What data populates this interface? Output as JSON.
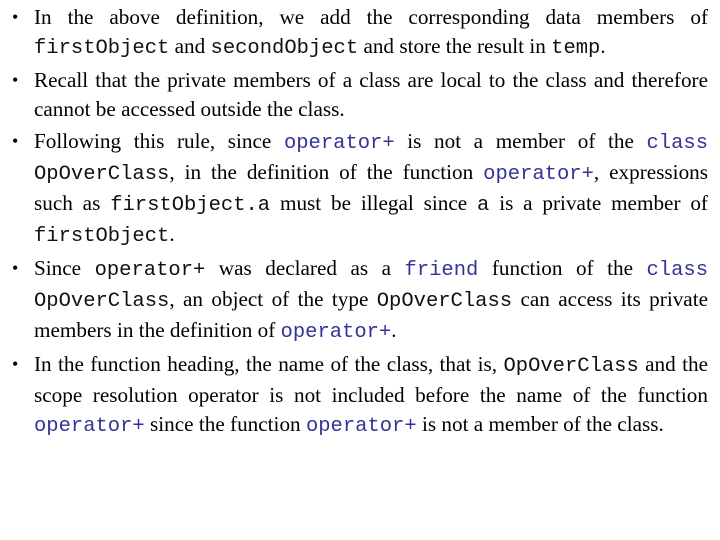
{
  "colors": {
    "text": "#000000",
    "code": "#111111",
    "keyword_code": "#333399",
    "background": "#ffffff"
  },
  "bullet_icon": "•",
  "bullets": [
    {
      "segments": [
        {
          "t": "text",
          "v": "In the above definition, we add the corresponding data members of "
        },
        {
          "t": "code",
          "v": "firstObject"
        },
        {
          "t": "text",
          "v": " and "
        },
        {
          "t": "code",
          "v": "secondObject"
        },
        {
          "t": "text",
          "v": " and store the result in "
        },
        {
          "t": "code",
          "v": "temp"
        },
        {
          "t": "text",
          "v": "."
        }
      ]
    },
    {
      "segments": [
        {
          "t": "text",
          "v": "Recall that the private members of a class are local to the class and therefore cannot be accessed outside the class."
        }
      ]
    },
    {
      "segments": [
        {
          "t": "text",
          "v": "Following this rule, since "
        },
        {
          "t": "kw",
          "v": "operator+"
        },
        {
          "t": "text",
          "v": " is not a member of the "
        },
        {
          "t": "kw",
          "v": "class"
        },
        {
          "t": "text",
          "v": " "
        },
        {
          "t": "code",
          "v": "OpOverClass"
        },
        {
          "t": "text",
          "v": ", in the definition of the function "
        },
        {
          "t": "kw",
          "v": "operator+"
        },
        {
          "t": "text",
          "v": ", expressions such as "
        },
        {
          "t": "code",
          "v": "firstObject.a"
        },
        {
          "t": "text",
          "v": " must be illegal since "
        },
        {
          "t": "code",
          "v": "a"
        },
        {
          "t": "text",
          "v": " is a private member of "
        },
        {
          "t": "code",
          "v": "firstObject"
        },
        {
          "t": "text",
          "v": "."
        }
      ]
    },
    {
      "segments": [
        {
          "t": "text",
          "v": "Since "
        },
        {
          "t": "code",
          "v": "operator+"
        },
        {
          "t": "text",
          "v": " was declared as a "
        },
        {
          "t": "kw",
          "v": "friend"
        },
        {
          "t": "text",
          "v": " function of the "
        },
        {
          "t": "kw",
          "v": "class"
        },
        {
          "t": "text",
          "v": " "
        },
        {
          "t": "code",
          "v": "OpOverClass"
        },
        {
          "t": "text",
          "v": ", an object of the type "
        },
        {
          "t": "code",
          "v": "OpOverClass"
        },
        {
          "t": "text",
          "v": " can access its private members in the definition of "
        },
        {
          "t": "kw",
          "v": "operator+"
        },
        {
          "t": "text",
          "v": "."
        }
      ]
    },
    {
      "segments": [
        {
          "t": "text",
          "v": "In the function heading, the name of the class, that is, "
        },
        {
          "t": "code",
          "v": "OpOverClass"
        },
        {
          "t": "text",
          "v": " and the scope resolution operator is not included before the name of the function "
        },
        {
          "t": "kw",
          "v": "operator+"
        },
        {
          "t": "text",
          "v": " since the function "
        },
        {
          "t": "kw",
          "v": "operator+"
        },
        {
          "t": "text",
          "v": " is not a member of the class."
        }
      ]
    }
  ]
}
